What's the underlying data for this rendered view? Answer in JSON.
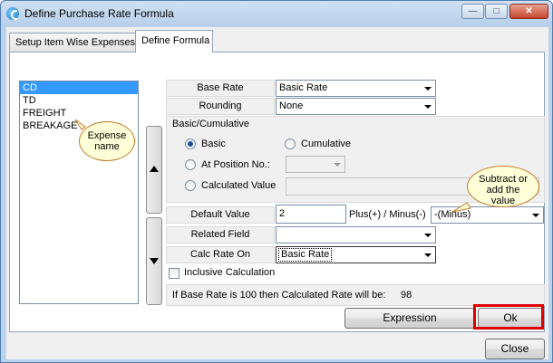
{
  "window": {
    "title": "Define Purchase Rate Formula"
  },
  "window_buttons": {
    "minimize": "—",
    "maximize": "□",
    "close": "✕"
  },
  "tabs": [
    {
      "label": "Setup Item Wise Expenses"
    },
    {
      "label": "Define Formula",
      "active": true
    }
  ],
  "expense_list": {
    "items": [
      "CD",
      "TD",
      "FREIGHT",
      "BREAKAGE"
    ],
    "selected": "CD"
  },
  "callouts": {
    "expense_name": "Expense name",
    "subtract_add": "Subtract or add the value"
  },
  "form": {
    "base_rate": {
      "label": "Base Rate",
      "value": "Basic Rate"
    },
    "rounding": {
      "label": "Rounding",
      "value": "None"
    },
    "basic_cumulative": {
      "title": "Basic/Cumulative",
      "basic": "Basic",
      "cumulative": "Cumulative",
      "at_position": "At Position No.:",
      "calculated_value": "Calculated Value",
      "selected": "Basic"
    },
    "default_value": {
      "label": "Default Value",
      "value": "2"
    },
    "plus_minus": {
      "label": "Plus(+) / Minus(-)",
      "value": "-(Minus)"
    },
    "related_field": {
      "label": "Related Field",
      "value": ""
    },
    "calc_rate_on": {
      "label": "Calc Rate On",
      "value": "Basic Rate"
    },
    "inclusive_calculation": {
      "label": "Inclusive Calculation",
      "checked": false
    },
    "info": {
      "text": "If Base Rate is 100 then Calculated Rate will be:",
      "value": "98"
    }
  },
  "buttons": {
    "expression": "Expression",
    "ok": "Ok",
    "close": "Close"
  },
  "colors": {
    "highlight_box": "#e00000",
    "selection": "#3399ff",
    "callout_fill": "#ffffd8"
  }
}
